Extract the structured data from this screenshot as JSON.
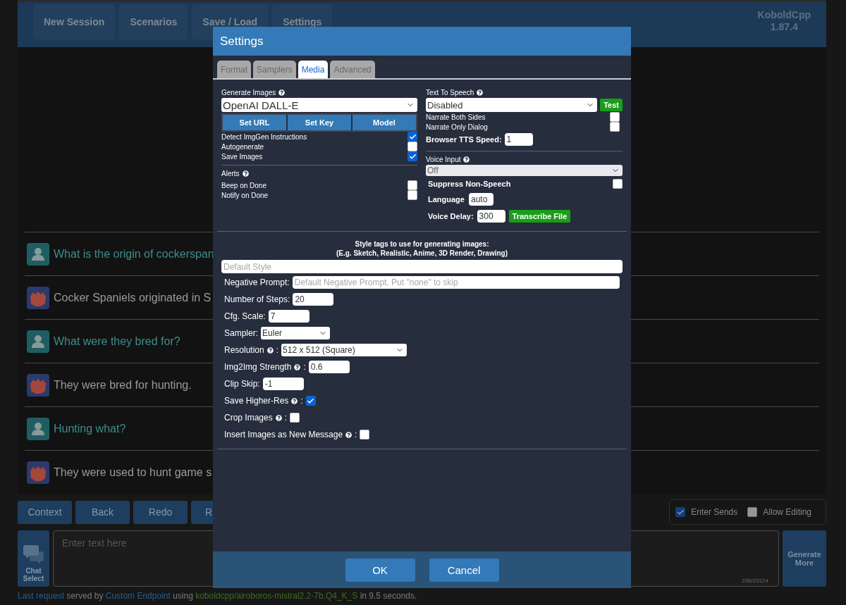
{
  "topbar": {
    "nav": [
      "New Session",
      "Scenarios",
      "Save / Load",
      "Settings"
    ],
    "brand": [
      "KoboldCpp",
      "1.87.4"
    ]
  },
  "messages": [
    {
      "kind": "user",
      "text": "What is the origin of cockerspan"
    },
    {
      "kind": "bot",
      "text": "Cocker Spaniels originated in S"
    },
    {
      "kind": "user",
      "text": "What were they bred for?"
    },
    {
      "kind": "bot",
      "text": "They were bred for hunting."
    },
    {
      "kind": "user",
      "text": "Hunting what?"
    },
    {
      "kind": "bot",
      "text": "They were used to hunt game s"
    }
  ],
  "actions": [
    "Context",
    "Back",
    "Redo",
    "R"
  ],
  "options": [
    {
      "label": "Enter Sends",
      "checked": true
    },
    {
      "label": "Allow Editing",
      "checked": false
    }
  ],
  "composer": {
    "chat_select": "Chat Select",
    "placeholder": "Enter text here",
    "counter": "236/23124",
    "generate": "Generate More"
  },
  "footer": [
    {
      "kind": "link",
      "text": "Last request"
    },
    {
      "kind": "plain",
      "text": " served by "
    },
    {
      "kind": "link",
      "text": "Custom Endpoint"
    },
    {
      "kind": "plain",
      "text": " using "
    },
    {
      "kind": "model",
      "text": "koboldcpp/airoboros-mistral2.2-7b.Q4_K_S"
    },
    {
      "kind": "plain",
      "text": " in 9.5 seconds."
    }
  ],
  "dialog": {
    "title": "Settings",
    "tabs": [
      {
        "label": "Format",
        "selected": false
      },
      {
        "label": "Samplers",
        "selected": false
      },
      {
        "label": "Media",
        "selected": true
      },
      {
        "label": "Advanced",
        "selected": false
      }
    ],
    "image_gen": {
      "label": "Generate Images",
      "select": "OpenAI DALL-E",
      "buttons": [
        "Set URL",
        "Set Key",
        "Model"
      ],
      "toggles": [
        {
          "label": "Detect ImgGen Instructions",
          "checked": true
        },
        {
          "label": "Autogenerate",
          "checked": false
        },
        {
          "label": "Save Images",
          "checked": true
        }
      ]
    },
    "alerts": {
      "label": "Alerts",
      "toggles": [
        {
          "label": "Beep on Done",
          "checked": false
        },
        {
          "label": "Notify on Done",
          "checked": false
        }
      ]
    },
    "tts": {
      "label": "Text To Speech",
      "select": "Disabled",
      "test_button": "Test",
      "toggles": [
        {
          "label": "Narrate Both Sides",
          "checked": false
        },
        {
          "label": "Narrate Only Dialog",
          "checked": false
        }
      ],
      "speed_label": "Browser TTS Speed:",
      "speed": "1"
    },
    "voice_input": {
      "label": "Voice Input",
      "select": "Off",
      "suppress": {
        "label": "Suppress Non-Speech",
        "checked": false
      },
      "language_label": "Language",
      "language": "auto",
      "delay_label": "Voice Delay:",
      "delay": "300",
      "transcribe_button": "Transcribe File"
    },
    "style": {
      "heading": [
        "Style tags to use for generating images:",
        "(E.g. Sketch, Realistic, Anime, 3D Render, Drawing)"
      ],
      "placeholder": "Default Style"
    },
    "fields": [
      {
        "kind": "text",
        "label": "Negative Prompt:",
        "help": false,
        "placeholder": "Default Negative Prompt. Put \"none\" to skip"
      },
      {
        "kind": "number",
        "label": "Number of Steps:",
        "help": false,
        "value": "20"
      },
      {
        "kind": "number",
        "label": "Cfg. Scale:",
        "help": false,
        "value": "7"
      },
      {
        "kind": "select",
        "label": "Sampler:",
        "help": false,
        "value": "Euler"
      },
      {
        "kind": "select",
        "label": "Resolution",
        "help": true,
        "suffix": ":",
        "value": "512 x 512 (Square)"
      },
      {
        "kind": "number",
        "label": "Img2Img Strength",
        "help": true,
        "suffix": ":",
        "value": "0.6"
      },
      {
        "kind": "number",
        "label": "Clip Skip:",
        "help": false,
        "value": "-1"
      },
      {
        "kind": "checkbox",
        "label": "Save Higher-Res",
        "help": true,
        "suffix": ":",
        "checked": true
      },
      {
        "kind": "checkbox",
        "label": "Crop Images",
        "help": true,
        "suffix": ":",
        "checked": false
      },
      {
        "kind": "checkbox",
        "label": "Insert Images as New Message",
        "help": true,
        "suffix": ":",
        "checked": false
      }
    ],
    "buttons": [
      "OK",
      "Cancel"
    ]
  }
}
